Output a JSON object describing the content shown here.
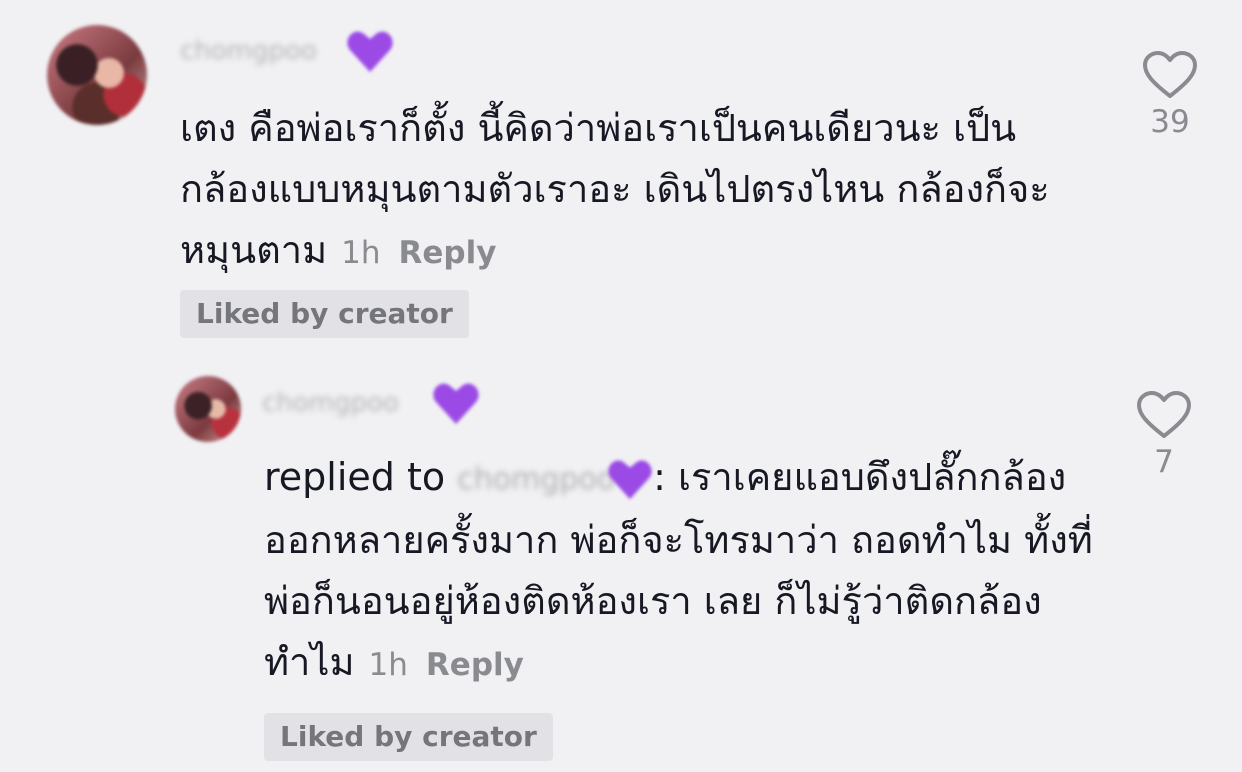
{
  "comments": [
    {
      "username": "chomgpoo",
      "text": "เตง คือพ่อเราก็ตั้ง นี้คิดว่าพ่อเราเป็นคนเดียวนะ เป็นกล้องแบบหมุนตามตัวเราอะ เดินไปตรงไหน กล้องก็จะหมุนตาม",
      "time": "1h",
      "reply_label": "Reply",
      "liked_chip": "Liked by creator",
      "like_count": "39"
    },
    {
      "username": "chomgpoo",
      "replied_label": "replied to",
      "replied_user": "chomgpoo",
      "separator": ":",
      "text": "เราเคยแอบดึงปลั๊กกล้องออกหลายครั้งมาก พ่อก็จะโทรมาว่า ถอดทำไม ทั้งที่พ่อก็นอนอยู่ห้องติดห้องเรา เลย ก็ไม่รู้ว่าติดกล้องทำไม",
      "time": "1h",
      "reply_label": "Reply",
      "liked_chip": "Liked by creator",
      "like_count": "7"
    }
  ],
  "icons": {
    "heart_outline": "heart-icon",
    "user_badge": "purple-heart-badge-icon"
  },
  "colors": {
    "background": "#f1f0f3",
    "text": "#161823",
    "muted": "#8a8b91",
    "badge_purple": "#9b4ae6",
    "chip_bg": "#e2e2e6"
  }
}
